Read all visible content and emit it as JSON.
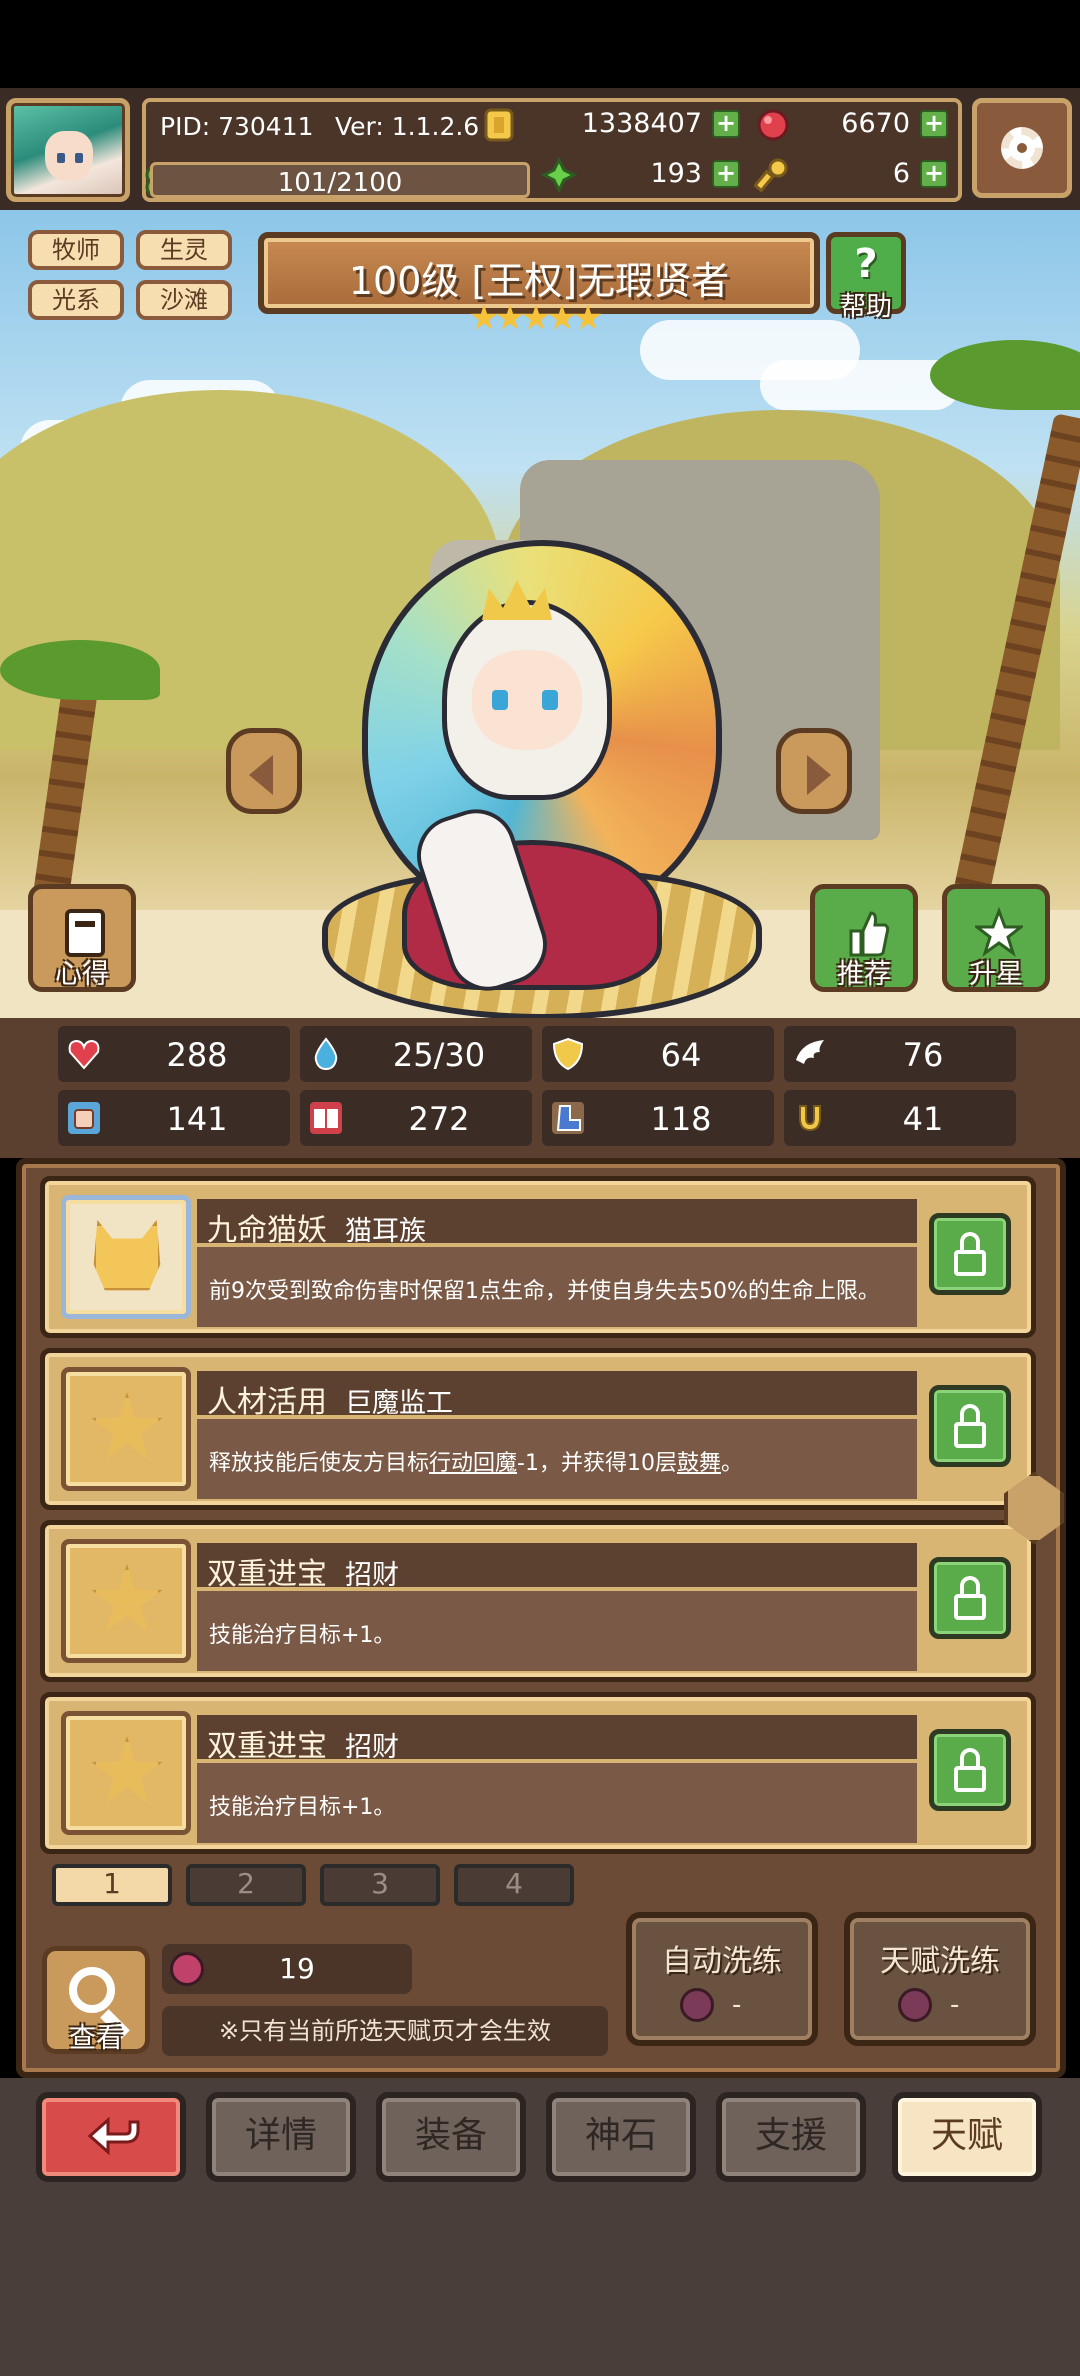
{
  "hud": {
    "pid": "PID: 730411",
    "version": "Ver: 1.1.2.6",
    "xp": "101/2100",
    "gold": "1338407",
    "gems": "6670",
    "clover": "193",
    "keys": "6"
  },
  "tags": [
    "牧师",
    "生灵",
    "光系",
    "沙滩"
  ],
  "title": {
    "text": "100级 [王权]无瑕贤者",
    "stars": 5,
    "help_label": "帮助"
  },
  "side_buttons": {
    "notes": "心得",
    "recommend": "推荐",
    "star_up": "升星"
  },
  "stats": [
    "288",
    "25/30",
    "64",
    "76",
    "141",
    "272",
    "118",
    "41"
  ],
  "talents": [
    {
      "name": "九命猫妖",
      "sub": "猫耳族",
      "desc": "前9次受到致命伤害时保留1点生命，并使自身失去50%的生命上限。"
    },
    {
      "name": "人材活用",
      "sub": "巨魔监工",
      "desc_a": "释放技能后使友方目标",
      "desc_u1": "行动回魔",
      "desc_b": "-1，并获得10层",
      "desc_u2": "鼓舞",
      "desc_c": "。"
    },
    {
      "name": "双重进宝",
      "sub": "招财",
      "desc": "技能治疗目标+1。"
    },
    {
      "name": "双重进宝",
      "sub": "招财",
      "desc": "技能治疗目标+1。"
    }
  ],
  "pages": [
    "1",
    "2",
    "3",
    "4"
  ],
  "bottom_controls": {
    "view_label": "查看",
    "fruit_count": "19",
    "note": "※只有当前所选天赋页才会生效",
    "auto_wash": "自动洗练",
    "auto_wash_cost": "-",
    "talent_wash": "天赋洗练",
    "talent_wash_cost": "-"
  },
  "nav": [
    "详情",
    "装备",
    "神石",
    "支援",
    "天赋"
  ],
  "colors": {
    "accent_green": "#5aab4a",
    "back_red": "#d84b4b",
    "active_tab": "#f6e4c2"
  }
}
